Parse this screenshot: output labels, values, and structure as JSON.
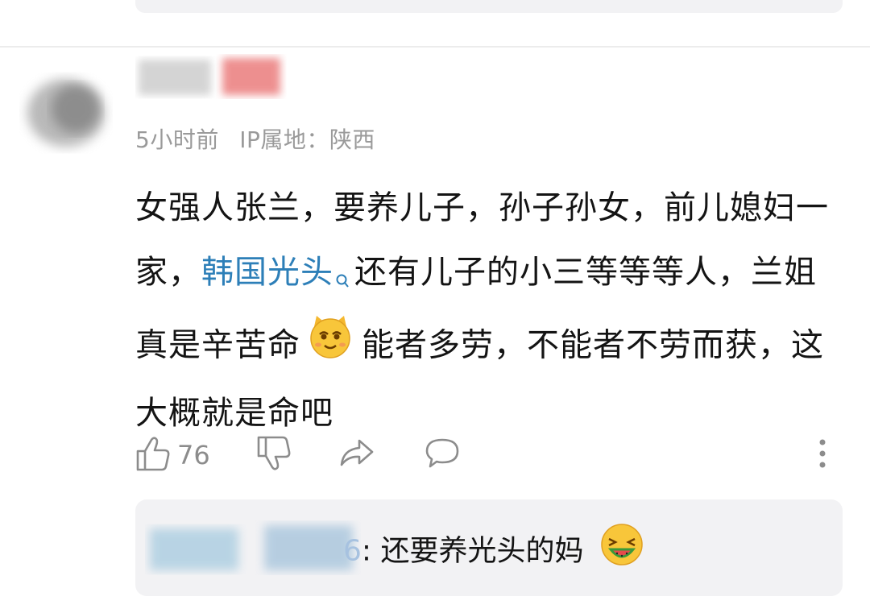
{
  "comment": {
    "time": "5小时前",
    "ip_location": "IP属地：陕西",
    "text_part1": "女强人张兰，要养儿子，孙子孙女，前儿媳妇一家，",
    "topic_link": "韩国光头",
    "text_part2": "还有儿子的小三等等等人，兰姐真是辛苦命",
    "text_part3": "能者多劳，不能者不劳而获，这大概就是命吧",
    "inline_emoji": "cat-emoji",
    "like_count": "76"
  },
  "reply": {
    "username_tail": "6",
    "separator": ":",
    "text": "还要养光头的妈",
    "emoji": "laughing-watermelon-emoji"
  },
  "icons": {
    "like": "thumbs-up-icon",
    "dislike": "thumbs-down-icon",
    "share": "share-icon",
    "reply": "comment-bubble-icon",
    "more": "more-vertical-icon",
    "topic_search": "search-icon"
  },
  "colors": {
    "link": "#2d7fb8",
    "meta": "#9a9a9a",
    "reply_bg": "#f2f2f4"
  }
}
